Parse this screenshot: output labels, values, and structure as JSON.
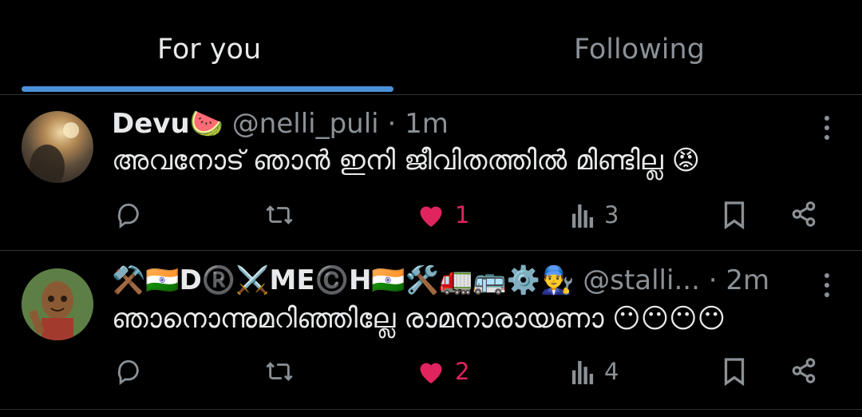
{
  "tabs": [
    {
      "label": "For you"
    },
    {
      "label": "Following"
    }
  ],
  "posts": [
    {
      "name": "Devu🍉",
      "handle": "@nelli_puli",
      "separator": "·",
      "time": "1m",
      "text": "അവനോട് ഞാൻ ഇനി ജീവിതത്തിൽ മിണ്ടില്ല 😡",
      "likes": "1",
      "views": "3"
    },
    {
      "name": "⚒️🇮🇳D®️⚔️ME©️H🇮🇳🛠️🚛🚌⚙️👨‍🔧",
      "handle": "@stalli...",
      "separator": "·",
      "time": "2m",
      "text": "ഞാനൊന്നുമറിഞ്ഞില്ലേ രാമനാരായണാ 😶😶😶😶",
      "likes": "2",
      "views": "4"
    }
  ],
  "colors": {
    "background": "#000000",
    "accent": "#4a90d9",
    "muted": "#8b9196",
    "like": "#e0245e"
  },
  "icons": [
    "reply-icon",
    "retweet-icon",
    "heart-icon",
    "views-icon",
    "bookmark-icon",
    "share-icon",
    "more-icon"
  ]
}
